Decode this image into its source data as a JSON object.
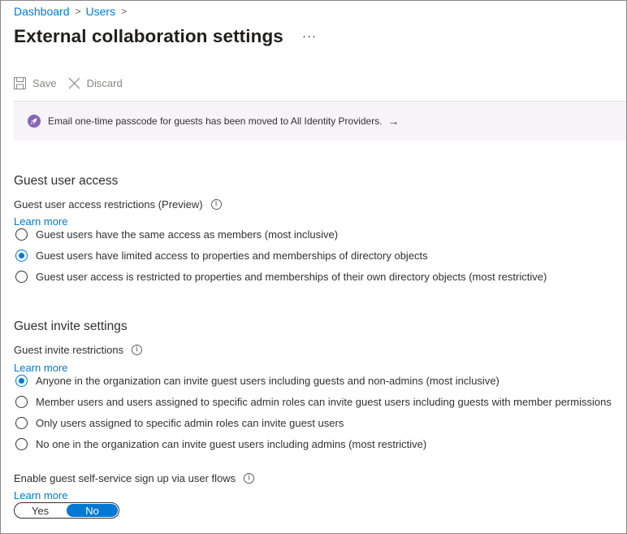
{
  "breadcrumb": {
    "items": [
      "Dashboard",
      "Users"
    ]
  },
  "page": {
    "title": "External collaboration settings",
    "more": "···"
  },
  "toolbar": {
    "save_label": "Save",
    "discard_label": "Discard"
  },
  "banner": {
    "text": "Email one-time passcode for guests has been moved to All Identity Providers.",
    "arrow": "→"
  },
  "guest_access": {
    "title": "Guest user access",
    "label": "Guest user access restrictions (Preview)",
    "learn_more": "Learn more",
    "options": [
      "Guest users have the same access as members (most inclusive)",
      "Guest users have limited access to properties and memberships of directory objects",
      "Guest user access is restricted to properties and memberships of their own directory objects (most restrictive)"
    ],
    "selected_index": 1
  },
  "guest_invite": {
    "title": "Guest invite settings",
    "label": "Guest invite restrictions",
    "learn_more": "Learn more",
    "options": [
      "Anyone in the organization can invite guest users including guests and non-admins (most inclusive)",
      "Member users and users assigned to specific admin roles can invite guest users including guests with member permissions",
      "Only users assigned to specific admin roles can invite guest users",
      "No one in the organization can invite guest users including admins (most restrictive)"
    ],
    "selected_index": 0
  },
  "self_service": {
    "label": "Enable guest self-service sign up via user flows",
    "learn_more": "Learn more",
    "yes_label": "Yes",
    "no_label": "No",
    "selected": "No"
  },
  "colors": {
    "accent": "#0078d4",
    "banner_bg": "#f7f4f9",
    "badge": "#8764b8"
  }
}
